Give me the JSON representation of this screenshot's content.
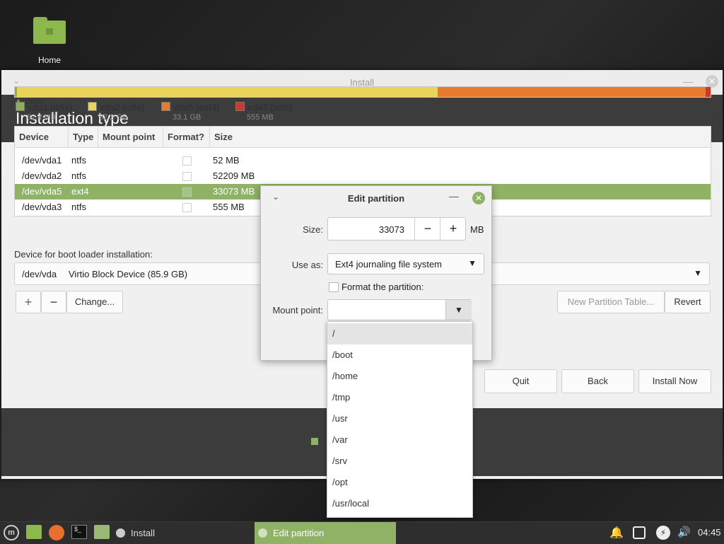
{
  "desktop": {
    "home_label": "Home"
  },
  "window": {
    "title": "Install",
    "heading": "Installation type",
    "bar_tooltip": "there"
  },
  "legend": [
    {
      "name": "vda1 (ntfs)",
      "size": "52.4 MB",
      "color": "#8fb04e"
    },
    {
      "name": "vda2 (ntfs)",
      "size": "52.2 GB",
      "color": "#e8d35b"
    },
    {
      "name": "vda5 (ext4)",
      "size": "33.1 GB",
      "color": "#e87a2e"
    },
    {
      "name": "vda3 (ntfs)",
      "size": "555 MB",
      "color": "#c73b2c"
    }
  ],
  "table": {
    "headers": [
      "Device",
      "Type",
      "Mount point",
      "Format?",
      "Size"
    ],
    "rows": [
      {
        "device": "/dev/vda1",
        "type": "ntfs",
        "size": "52 MB"
      },
      {
        "device": "/dev/vda2",
        "type": "ntfs",
        "size": "52209 MB"
      },
      {
        "device": "/dev/vda5",
        "type": "ext4",
        "size": "33073 MB"
      },
      {
        "device": "/dev/vda3",
        "type": "ntfs",
        "size": "555 MB"
      }
    ]
  },
  "buttons": {
    "add": "+",
    "remove": "−",
    "change": "Change...",
    "new_table": "New Partition Table...",
    "revert": "Revert",
    "quit": "Quit",
    "back": "Back",
    "install_now": "Install Now"
  },
  "boot": {
    "label": "Device for boot loader installation:",
    "device": "/dev/vda",
    "description": "Virtio Block Device (85.9 GB)"
  },
  "dialog": {
    "title": "Edit partition",
    "size_label": "Size:",
    "size_value": "33073",
    "size_unit": "MB",
    "use_as_label": "Use as:",
    "use_as_value": "Ext4 journaling file system",
    "format_label": "Format the partition:",
    "mount_label": "Mount point:",
    "mount_value": ""
  },
  "mount_options": [
    "/",
    "/boot",
    "/home",
    "/tmp",
    "/usr",
    "/var",
    "/srv",
    "/opt",
    "/usr/local"
  ],
  "taskbar": {
    "tasks": [
      "Install",
      "Edit partition"
    ],
    "clock": "04:45"
  }
}
